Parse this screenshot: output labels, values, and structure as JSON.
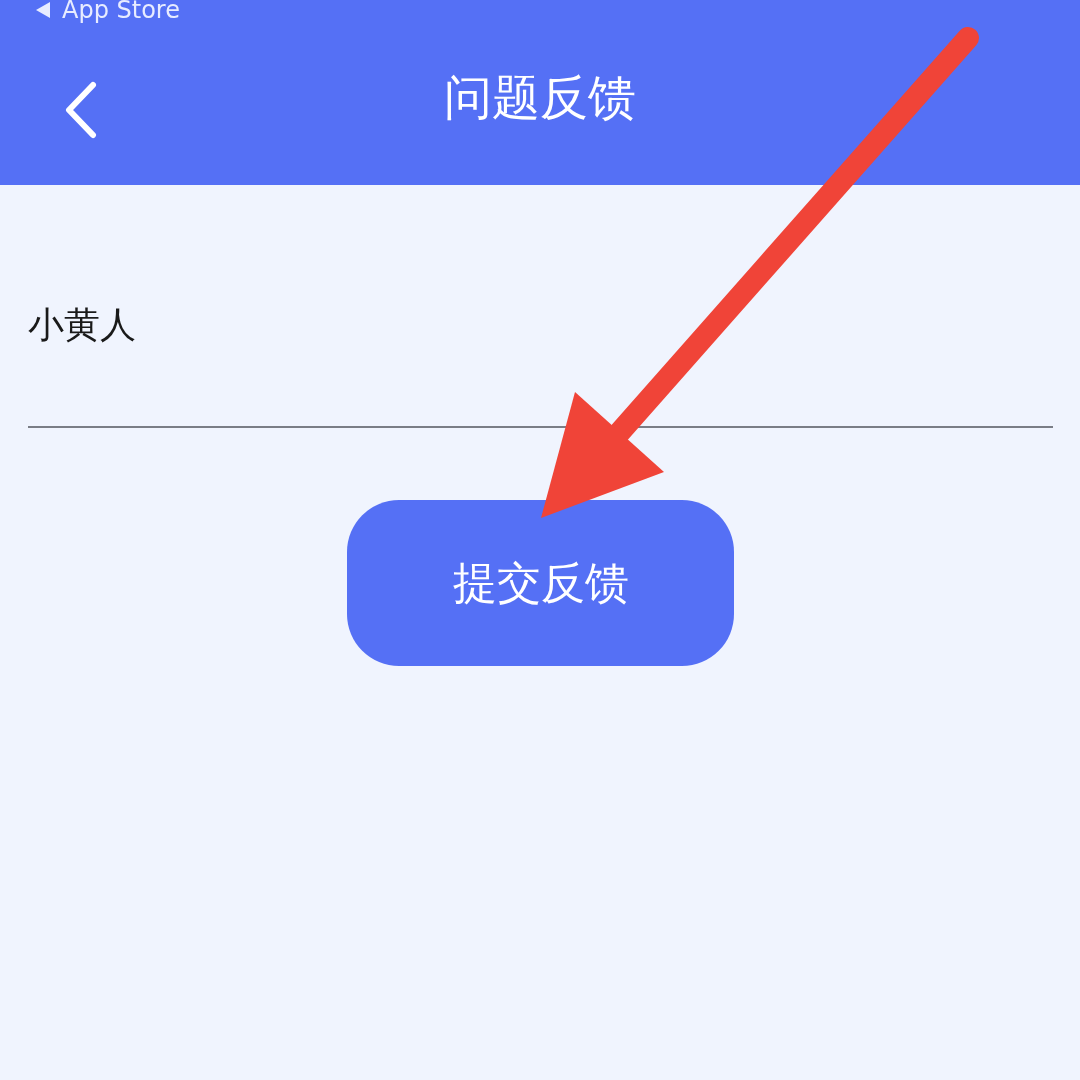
{
  "status_bar": {
    "back_label": "App Store"
  },
  "header": {
    "title": "问题反馈"
  },
  "feedback_field": {
    "value": "小黄人"
  },
  "submit_button": {
    "label": "提交反馈"
  }
}
